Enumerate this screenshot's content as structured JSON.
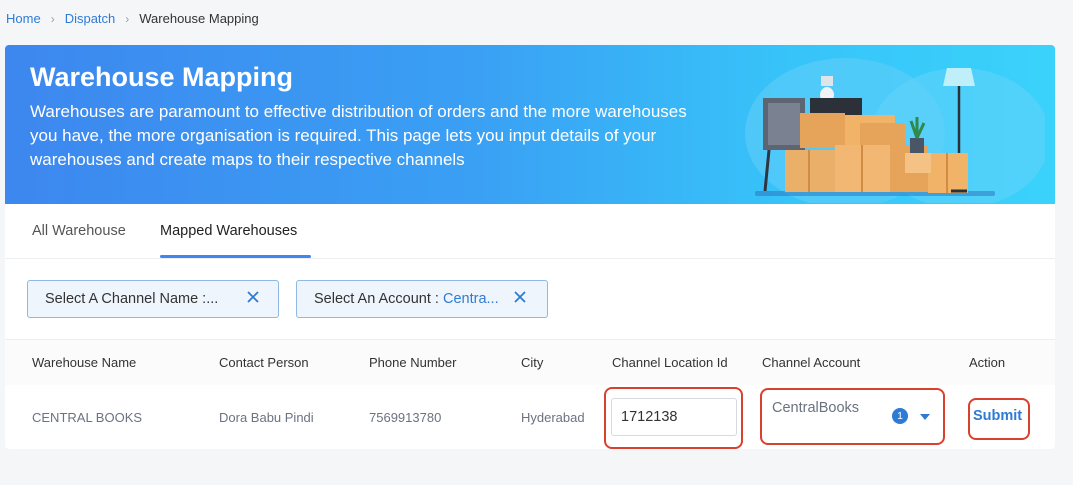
{
  "breadcrumb": {
    "home": "Home",
    "dispatch": "Dispatch",
    "current": "Warehouse Mapping"
  },
  "banner": {
    "title": "Warehouse Mapping",
    "description": "Warehouses are paramount to effective distribution of orders and the more warehouses you have, the more organisation is required. This page lets you input details of your warehouses and create maps to their respective channels"
  },
  "tabs": [
    {
      "label": "All Warehouse"
    },
    {
      "label": "Mapped Warehouses"
    }
  ],
  "filters": {
    "channel": {
      "label": "Select A Channel Name : ",
      "value": "..."
    },
    "account": {
      "label": "Select An Account : ",
      "value": "Centra..."
    }
  },
  "table": {
    "headers": [
      "Warehouse Name",
      "Contact Person",
      "Phone Number",
      "City",
      "Channel Location Id",
      "Channel Account",
      "Action"
    ],
    "row": {
      "warehouse_name": "CENTRAL BOOKS",
      "contact_person": "Dora Babu Pindi",
      "phone_number": "7569913780",
      "city": "Hyderabad",
      "channel_location_id": "1712138",
      "channel_account": "CentralBooks",
      "account_count": "1",
      "action": "Submit"
    }
  },
  "colors": {
    "accent": "#2e7bd6",
    "highlight": "#d9412f"
  }
}
